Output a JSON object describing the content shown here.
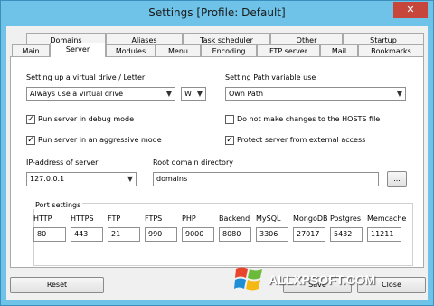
{
  "window": {
    "title": "Settings [Profile: Default]",
    "close": "✕"
  },
  "tabs_row1": [
    "Domains",
    "Aliases",
    "Task scheduler",
    "Other",
    "Startup"
  ],
  "tabs_row2": [
    "Main",
    "Server",
    "Modules",
    "Menu",
    "Encoding",
    "FTP server",
    "Mail",
    "Bookmarks"
  ],
  "server": {
    "vdrive_label": "Setting up a virtual drive / Letter",
    "vdrive_value": "Always use a virtual drive",
    "letter_value": "W",
    "path_label": "Setting Path variable use",
    "path_value": "Own Path",
    "debug_label": "Run server in debug mode",
    "hosts_label": "Do not make changes to the HOSTS file",
    "aggressive_label": "Run server in an aggressive mode",
    "protect_label": "Protect server from external access",
    "ip_label": "IP-address of server",
    "ip_value": "127.0.0.1",
    "root_label": "Root domain directory",
    "root_value": "domains",
    "browse": "...",
    "ports_title": "Port settings",
    "ports": [
      {
        "name": "HTTP",
        "value": "80"
      },
      {
        "name": "HTTPS",
        "value": "443"
      },
      {
        "name": "FTP",
        "value": "21"
      },
      {
        "name": "FTPS",
        "value": "990"
      },
      {
        "name": "PHP",
        "value": "9000"
      },
      {
        "name": "Backend",
        "value": "8080"
      },
      {
        "name": "MySQL",
        "value": "3306"
      },
      {
        "name": "MongoDB",
        "value": "27017"
      },
      {
        "name": "Postgres",
        "value": "5432"
      },
      {
        "name": "Memcache",
        "value": "11211"
      }
    ]
  },
  "checks": {
    "debug": true,
    "hosts": false,
    "aggressive": true,
    "protect": true
  },
  "buttons": {
    "reset": "Reset",
    "save": "Save",
    "close": "Close"
  },
  "watermark": "ALLXPSOFT.COM",
  "colors": {
    "titlebar": "#6fc3e8",
    "close": "#c7463b"
  }
}
